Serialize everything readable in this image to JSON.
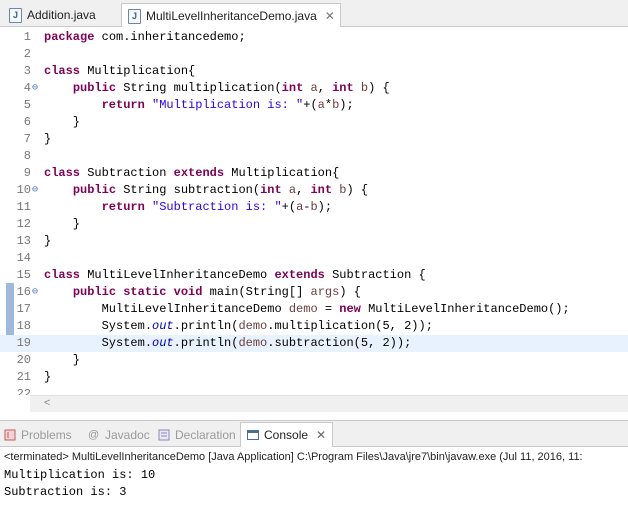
{
  "tabs": [
    {
      "label": "Addition.java",
      "active": false
    },
    {
      "label": "MultiLevelInheritanceDemo.java",
      "active": true,
      "close": "✕"
    }
  ],
  "code_lines": [
    {
      "n": "1",
      "html": "<span class=\"kw\">package</span> com.inheritancedemo;"
    },
    {
      "n": "2",
      "html": ""
    },
    {
      "n": "3",
      "html": "<span class=\"kw\">class</span> Multiplication{"
    },
    {
      "n": "4",
      "html": "    <span class=\"kw\">public</span> String multiplication(<span class=\"kw\">int</span> <span class=\"var\">a</span>, <span class=\"kw\">int</span> <span class=\"var\">b</span>) {",
      "fold": "⊖"
    },
    {
      "n": "5",
      "html": "        <span class=\"kw\">return</span> <span class=\"str\">\"Multiplication is: \"</span>+(<span class=\"var\">a</span>*<span class=\"var\">b</span>);"
    },
    {
      "n": "6",
      "html": "    }"
    },
    {
      "n": "7",
      "html": "}"
    },
    {
      "n": "8",
      "html": ""
    },
    {
      "n": "9",
      "html": "<span class=\"kw\">class</span> Subtraction <span class=\"kw\">extends</span> Multiplication{"
    },
    {
      "n": "10",
      "html": "    <span class=\"kw\">public</span> String subtraction(<span class=\"kw\">int</span> <span class=\"var\">a</span>, <span class=\"kw\">int</span> <span class=\"var\">b</span>) {",
      "fold": "⊖"
    },
    {
      "n": "11",
      "html": "        <span class=\"kw\">return</span> <span class=\"str\">\"Subtraction is: \"</span>+(<span class=\"var\">a</span>-<span class=\"var\">b</span>);"
    },
    {
      "n": "12",
      "html": "    }"
    },
    {
      "n": "13",
      "html": "}"
    },
    {
      "n": "14",
      "html": ""
    },
    {
      "n": "15",
      "html": "<span class=\"kw\">class</span> MultiLevelInheritanceDemo <span class=\"kw\">extends</span> Subtraction {"
    },
    {
      "n": "16",
      "html": "    <span class=\"kw\">public</span> <span class=\"kw\">static</span> <span class=\"kw\">void</span> main(String[] <span class=\"var\">args</span>) {",
      "fold": "⊖"
    },
    {
      "n": "17",
      "html": "        MultiLevelInheritanceDemo <span class=\"var\">demo</span> = <span class=\"kw\">new</span> MultiLevelInheritanceDemo();"
    },
    {
      "n": "18",
      "html": "        System.<span class=\"fld\">out</span>.println(<span class=\"var\">demo</span>.multiplication(5, 2));"
    },
    {
      "n": "19",
      "html": "        System.<span class=\"fld\">out</span>.println(<span class=\"var\">demo</span>.subtraction(5, 2));",
      "current": true
    },
    {
      "n": "20",
      "html": "    }"
    },
    {
      "n": "21",
      "html": "}"
    },
    {
      "n": "22",
      "html": ""
    }
  ],
  "scroll_arrow": "<",
  "console_tabs": [
    {
      "label": "Problems",
      "icon": "problems-icon",
      "active": false
    },
    {
      "label": "Javadoc",
      "icon": "javadoc-icon",
      "active": false,
      "glyph": "@"
    },
    {
      "label": "Declaration",
      "icon": "declaration-icon",
      "active": false
    },
    {
      "label": "Console",
      "icon": "console-icon",
      "active": true,
      "close": "✕"
    }
  ],
  "console": {
    "status": "<terminated> MultiLevelInheritanceDemo [Java Application] C:\\Program Files\\Java\\jre7\\bin\\javaw.exe (Jul 11, 2016, 11:",
    "output": [
      "Multiplication is: 10",
      "Subtraction is: 3"
    ]
  }
}
